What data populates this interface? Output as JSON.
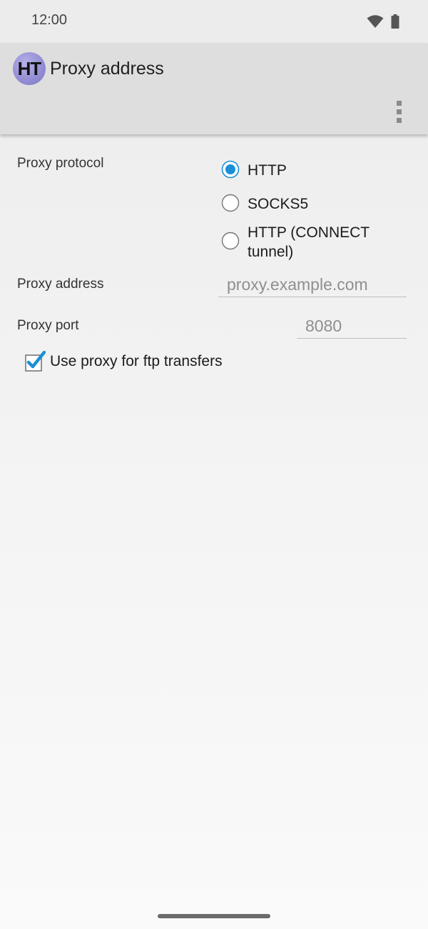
{
  "status_bar": {
    "time": "12:00",
    "icons": [
      "wifi-icon",
      "battery-icon"
    ]
  },
  "app_bar": {
    "logo_text": "HT",
    "title": "Proxy address",
    "menu_icon": "overflow-menu-icon"
  },
  "form": {
    "protocol": {
      "label": "Proxy protocol",
      "options": [
        {
          "label": "HTTP",
          "selected": true
        },
        {
          "label": "SOCKS5",
          "selected": false
        },
        {
          "label": "HTTP (CONNECT tunnel)",
          "selected": false
        }
      ]
    },
    "address": {
      "label": "Proxy address",
      "placeholder": "proxy.example.com",
      "value": ""
    },
    "port": {
      "label": "Proxy port",
      "placeholder": "8080",
      "value": ""
    },
    "ftp_checkbox": {
      "label": "Use proxy for ftp transfers",
      "checked": true
    }
  },
  "colors": {
    "accent": "#1a8fd6",
    "app_bar": "#dedede",
    "status_bar": "#ececec"
  }
}
